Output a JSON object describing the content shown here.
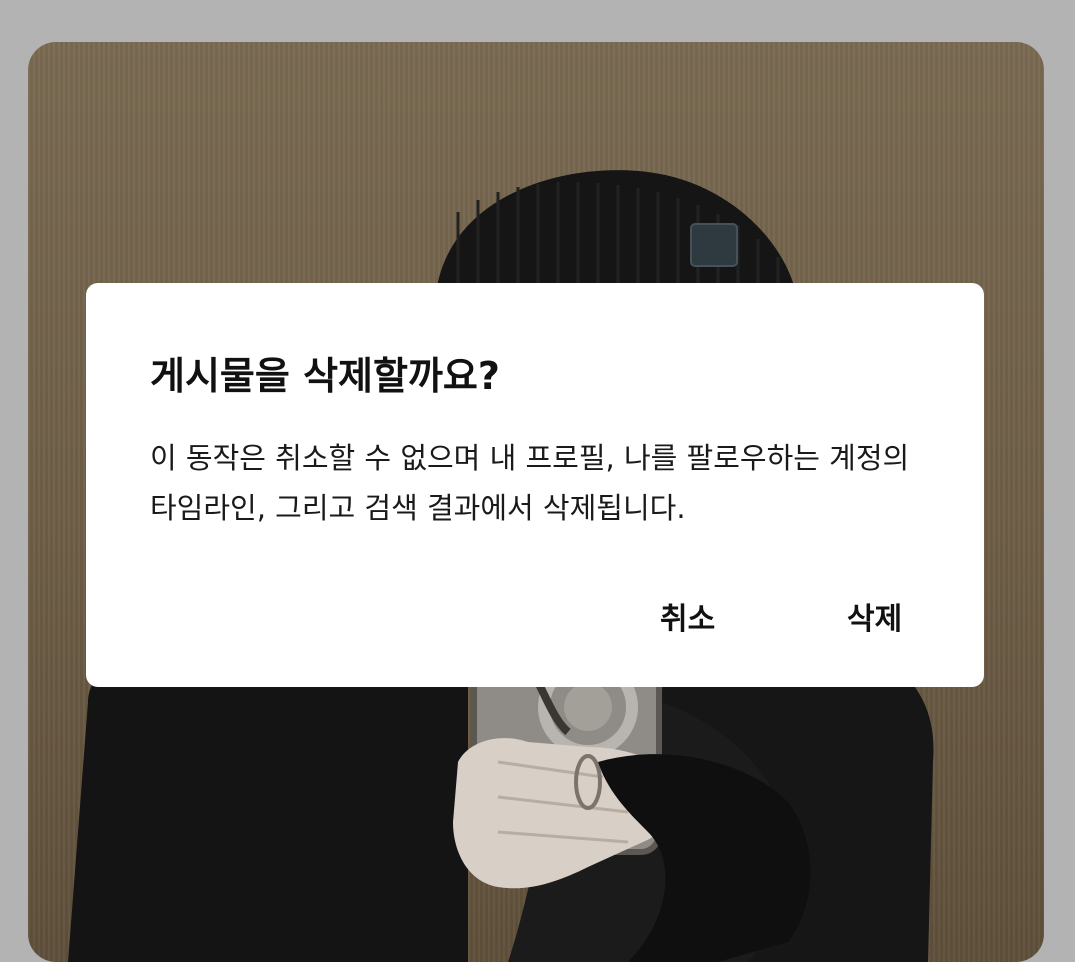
{
  "dialog": {
    "title": "게시물을 삭제할까요?",
    "message": "이 동작은 취소할 수 없으며 내 프로필, 나를 팔로우하는 계정의 타임라인, 그리고 검색 결과에서 삭제됩니다.",
    "cancel_label": "취소",
    "delete_label": "삭제"
  },
  "colors": {
    "scrim": "#b3b3b3",
    "dialog_background": "#ffffff",
    "text": "#111111"
  }
}
